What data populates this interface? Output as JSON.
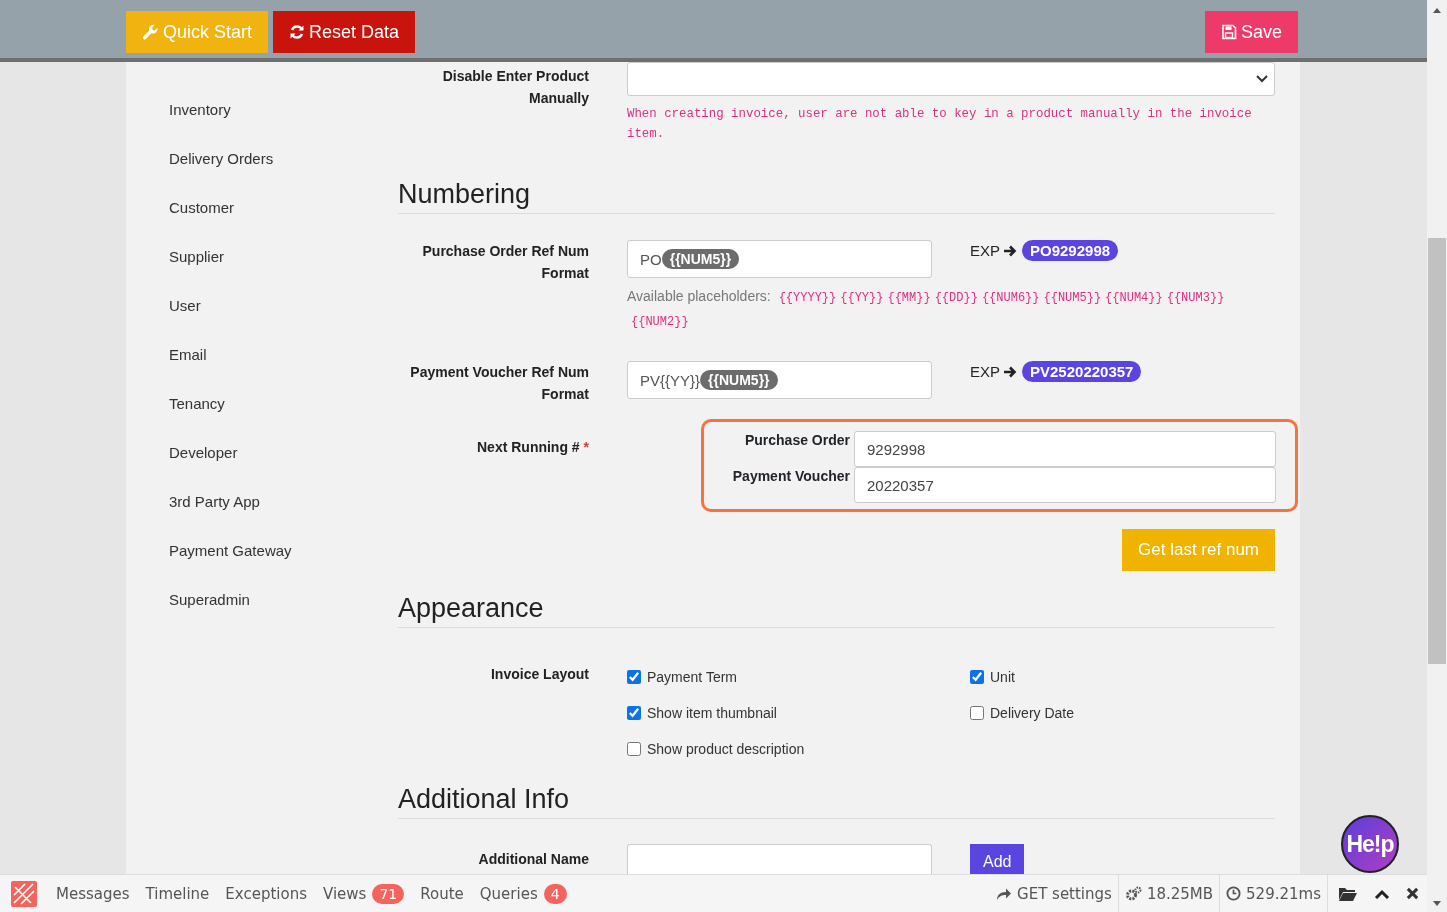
{
  "toolbar": {
    "buttons": [
      {
        "label": "Quick Start",
        "kind": "quick-start"
      },
      {
        "label": "Reset Data",
        "kind": "reset"
      }
    ],
    "save": {
      "label": "Save"
    }
  },
  "sidebar": {
    "items": [
      {
        "label": "Inventory",
        "selected": false
      },
      {
        "label": "Delivery Orders",
        "selected": false
      },
      {
        "label": "Customer",
        "selected": false
      },
      {
        "label": "Supplier",
        "selected": false
      },
      {
        "label": "User",
        "selected": false
      },
      {
        "label": "Email",
        "selected": false
      },
      {
        "label": "Tenancy",
        "selected": false
      },
      {
        "label": "Developer",
        "selected": false
      },
      {
        "label": "3rd Party App",
        "selected": false
      },
      {
        "label": "Payment Gateway",
        "selected": false
      },
      {
        "label": "Superadmin",
        "selected": false
      }
    ]
  },
  "disable_product": {
    "label": "Disable Enter Product Manually",
    "hint": "When creating invoice, user are not able to key in a product manually in the invoice item."
  },
  "numbering": {
    "title": "Numbering",
    "formats": [
      {
        "label": "Purchase Order Ref Num Format",
        "segments": [
          {
            "kind": "text",
            "text": "PO"
          },
          {
            "kind": "token",
            "text": "{{NUM5}}"
          }
        ],
        "exp_label": "EXP",
        "example": "PO9292998",
        "placeholders_label": "Available placeholders:",
        "placeholders": [
          "{{YYYY}}",
          "{{YY}}",
          "{{MM}}",
          "{{DD}}",
          "{{NUM6}}",
          "{{NUM5}}",
          "{{NUM4}}",
          "{{NUM3}}",
          "{{NUM2}}"
        ]
      },
      {
        "label": "Payment Voucher Ref Num Format",
        "segments": [
          {
            "kind": "text",
            "text": "PV{{YY}}"
          },
          {
            "kind": "token",
            "text": "{{NUM5}}"
          }
        ],
        "exp_label": "EXP",
        "example": "PV2520220357"
      }
    ],
    "next_running": {
      "label": "Next Running #",
      "required_mark": "*",
      "counters": [
        {
          "label": "Purchase Order",
          "value": "9292998"
        },
        {
          "label": "Payment Voucher",
          "value": "20220357"
        }
      ]
    },
    "get_last_button": "Get last ref num"
  },
  "appearance": {
    "title": "Appearance",
    "invoice_layout": {
      "label": "Invoice Layout",
      "options": [
        {
          "label": "Payment Term",
          "checked": true
        },
        {
          "label": "Unit",
          "checked": true
        },
        {
          "label": "Show item thumbnail",
          "checked": true
        },
        {
          "label": "Delivery Date",
          "checked": false
        },
        {
          "label": "Show product description",
          "checked": false
        }
      ]
    }
  },
  "additional_info": {
    "title": "Additional Info",
    "name_label": "Additional Name",
    "add_button": "Add"
  },
  "help_button": {
    "label": "He!p"
  },
  "debugbar": {
    "tabs": [
      {
        "label": "Messages"
      },
      {
        "label": "Timeline"
      },
      {
        "label": "Exceptions"
      },
      {
        "label": "Views",
        "badge": "71"
      },
      {
        "label": "Route"
      },
      {
        "label": "Queries",
        "badge": "4"
      }
    ],
    "route": "GET settings",
    "memory": "18.25MB",
    "time": "529.21ms"
  }
}
